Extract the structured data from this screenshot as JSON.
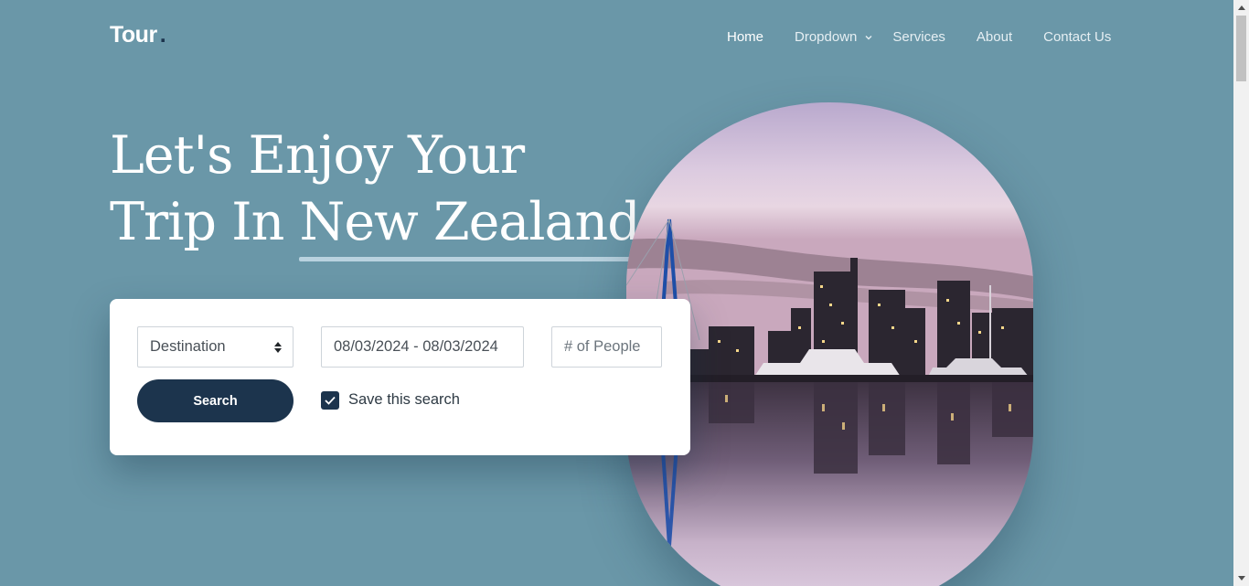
{
  "header": {
    "brand": "Tour",
    "brand_dot": ".",
    "nav": [
      {
        "label": "Home",
        "active": true
      },
      {
        "label": "Dropdown",
        "has_dropdown": true
      },
      {
        "label": "Services"
      },
      {
        "label": "About"
      },
      {
        "label": "Contact Us"
      }
    ]
  },
  "hero": {
    "line1": "Let's Enjoy Your",
    "line2_prefix": "Trip In ",
    "line2_highlight": "New Zealand."
  },
  "search": {
    "destination_value": "Destination",
    "date_range_value": "08/03/2024 - 08/03/2024",
    "people_placeholder": "# of People",
    "search_button": "Search",
    "save_checkbox_checked": true,
    "save_label": "Save this search"
  },
  "icons": {
    "dropdown": "chevron-down-icon",
    "select": "select-arrows-icon",
    "checkbox": "checkmark-icon"
  },
  "colors": {
    "background": "#6a97a8",
    "primary_dark": "#1c344d",
    "underline": "#b9d2df"
  }
}
